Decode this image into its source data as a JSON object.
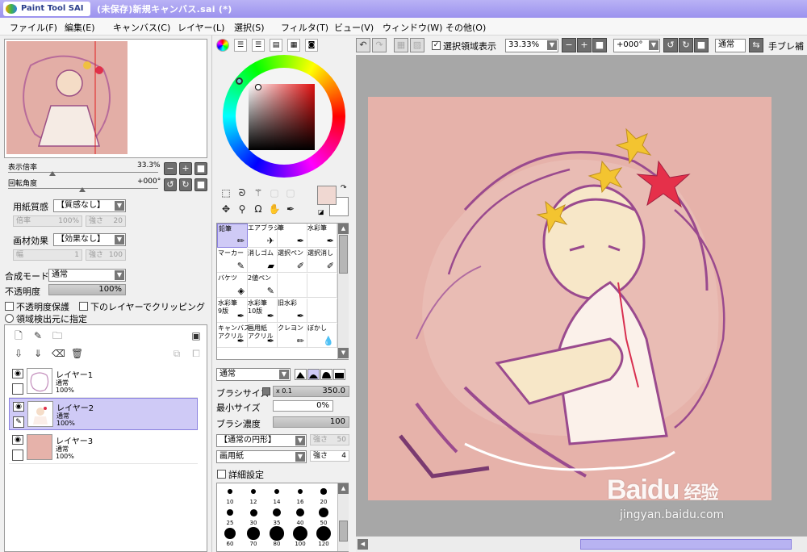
{
  "window": {
    "app_name": "Paint Tool SAI",
    "title": "(未保存)新規キャンバス.sai (*)"
  },
  "menu": [
    "ファイル(F)",
    "編集(E)",
    "キャンバス(C)",
    "レイヤー(L)",
    "選択(S)",
    "フィルタ(T)",
    "ビュー(V)",
    "ウィンドウ(W)",
    "その他(O)"
  ],
  "navigator": {
    "zoom_label": "表示倍率",
    "zoom_value": "33.3%",
    "rotation_label": "回転角度",
    "rotation_value": "+000°"
  },
  "paper": {
    "texture_label": "用紙質感",
    "texture_value": "【質感なし】",
    "texture_scale_label": "倍率",
    "texture_scale_value": "100%",
    "texture_strength_label": "強さ",
    "texture_strength_value": "20",
    "effect_label": "画材効果",
    "effect_value": "【効果なし】",
    "effect_width_label": "幅",
    "effect_width_value": "1",
    "effect_strength_label": "強さ",
    "effect_strength_value": "100"
  },
  "blend": {
    "mode_label": "合成モード",
    "mode_value": "通常",
    "opacity_label": "不透明度",
    "opacity_value": "100%",
    "preserve_opacity_label": "不透明度保護",
    "clip_label": "下のレイヤーでクリッピング",
    "detect_label": "領域検出元に指定"
  },
  "layers": [
    {
      "name": "レイヤー1",
      "mode": "通常",
      "opacity": "100%",
      "selected": false
    },
    {
      "name": "レイヤー2",
      "mode": "通常",
      "opacity": "100%",
      "selected": true
    },
    {
      "name": "レイヤー3",
      "mode": "通常",
      "opacity": "100%",
      "selected": false
    }
  ],
  "brushes": [
    {
      "name": "鉛筆",
      "icon": "pencil-icon",
      "selected": true
    },
    {
      "name": "エアブラシ",
      "icon": "airbrush-icon",
      "selected": false
    },
    {
      "name": "筆",
      "icon": "brush-icon",
      "selected": false
    },
    {
      "name": "水彩筆",
      "icon": "watercolor-icon",
      "selected": false
    },
    {
      "name": "マーカー",
      "icon": "marker-icon",
      "selected": false
    },
    {
      "name": "消しゴム",
      "icon": "eraser-icon",
      "selected": false
    },
    {
      "name": "選択ペン",
      "icon": "select-pen-icon",
      "selected": false
    },
    {
      "name": "選択消し",
      "icon": "select-erase-icon",
      "selected": false
    },
    {
      "name": "バケツ",
      "icon": "bucket-icon",
      "selected": false
    },
    {
      "name": "2値ペン",
      "icon": "binary-pen-icon",
      "selected": false
    },
    {
      "name": "",
      "icon": "",
      "selected": false
    },
    {
      "name": "",
      "icon": "",
      "selected": false
    },
    {
      "name": "水彩筆\n9版",
      "icon": "watercolor-icon",
      "selected": false
    },
    {
      "name": "水彩筆\n10版",
      "icon": "watercolor-icon",
      "selected": false
    },
    {
      "name": "旧水彩",
      "icon": "watercolor-icon",
      "selected": false
    },
    {
      "name": "",
      "icon": "",
      "selected": false
    },
    {
      "name": "キャンバス\nアクリル",
      "icon": "brush-icon",
      "selected": false
    },
    {
      "name": "画用紙\nアクリル",
      "icon": "brush-icon",
      "selected": false
    },
    {
      "name": "クレヨン",
      "icon": "crayon-icon",
      "selected": false
    },
    {
      "name": "ぼかし",
      "icon": "blur-icon",
      "selected": false
    }
  ],
  "brush_settings": {
    "mode_value": "通常",
    "size_label": "ブラシサイズ",
    "size_multiplier": "x 0.1",
    "size_value": "350.0",
    "min_size_label": "最小サイズ",
    "min_size_value": "0%",
    "density_label": "ブラシ濃度",
    "density_value": "100",
    "shape_value": "【通常の円形】",
    "shape_strength_label": "強さ",
    "shape_strength_value": "50",
    "texture_value": "画用紙",
    "texture_strength_label": "強さ",
    "texture_strength_value": "4",
    "advanced_label": "詳細設定"
  },
  "brush_sizes": [
    "10",
    "12",
    "14",
    "16",
    "20",
    "25",
    "30",
    "35",
    "40",
    "50",
    "60",
    "70",
    "80",
    "100",
    "120"
  ],
  "canvas_toolbar": {
    "show_selection_label": "選択領域表示",
    "zoom_value": "33.33%",
    "rotation_value": "+000°",
    "mode_value": "通常",
    "stabilizer_label": "手ブレ補正"
  },
  "watermark": {
    "brand": "Baidu",
    "brand_cn": "经验",
    "url": "jingyan.baidu.com"
  },
  "colors": {
    "canvas": "#e6b2aa",
    "accent": "#cfcaf6",
    "titlebar": "#a69df0"
  }
}
